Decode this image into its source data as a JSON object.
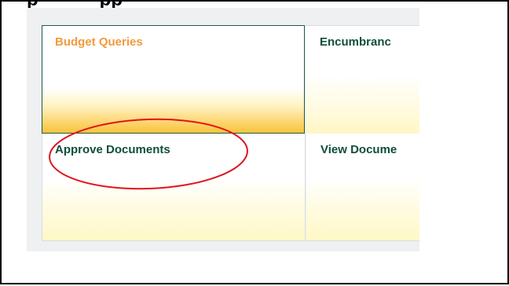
{
  "page": {
    "title_fragment_left": "p",
    "title_fragment_right": "pp"
  },
  "tiles": {
    "budget_queries": "Budget Queries",
    "encumbrance": "Encumbranc",
    "approve_documents": "Approve Documents",
    "view_documents": "View Docume"
  },
  "colors": {
    "accent_orange": "#f39a3c",
    "tile_text_green": "#0f4f3a",
    "selected_border": "#1e5b44",
    "highlight_gold": "#f8c43a",
    "annotation_red": "#e0141e"
  }
}
